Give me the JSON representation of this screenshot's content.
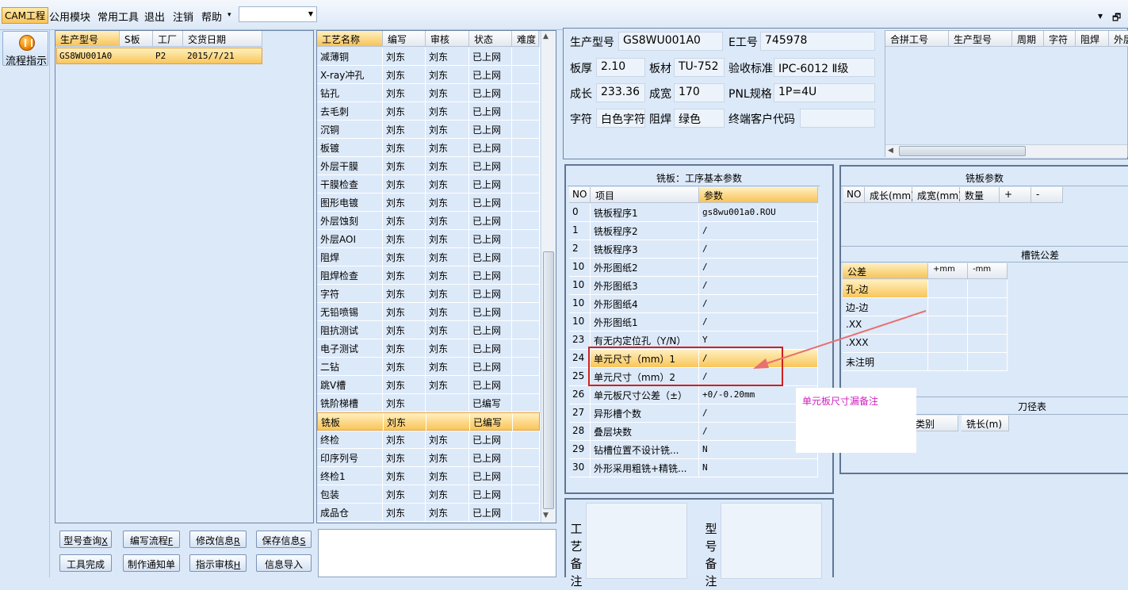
{
  "menubar": {
    "items": [
      "CAM工程",
      "公用模块",
      "常用工具",
      "退出",
      "注销",
      "帮助"
    ],
    "help_arrow": "▾",
    "combo_value": "",
    "window_controls": [
      "▾",
      "🗗"
    ]
  },
  "left_nav": {
    "flow_button": "流程指示"
  },
  "orders": {
    "columns": [
      "生产型号",
      "S板",
      "工厂",
      "交货日期"
    ],
    "rows": [
      [
        "GS8WU001A0",
        "",
        "P2",
        "2015/7/21"
      ]
    ]
  },
  "processes": {
    "columns": [
      "工艺名称",
      "编写",
      "审核",
      "状态",
      "难度"
    ],
    "rows": [
      [
        "减薄铜",
        "刘东",
        "刘东",
        "已上网",
        ""
      ],
      [
        "X-ray冲孔",
        "刘东",
        "刘东",
        "已上网",
        ""
      ],
      [
        "钻孔",
        "刘东",
        "刘东",
        "已上网",
        ""
      ],
      [
        "去毛刺",
        "刘东",
        "刘东",
        "已上网",
        ""
      ],
      [
        "沉铜",
        "刘东",
        "刘东",
        "已上网",
        ""
      ],
      [
        "板镀",
        "刘东",
        "刘东",
        "已上网",
        ""
      ],
      [
        "外层干膜",
        "刘东",
        "刘东",
        "已上网",
        ""
      ],
      [
        "干膜检查",
        "刘东",
        "刘东",
        "已上网",
        ""
      ],
      [
        "图形电镀",
        "刘东",
        "刘东",
        "已上网",
        ""
      ],
      [
        "外层蚀刻",
        "刘东",
        "刘东",
        "已上网",
        ""
      ],
      [
        "外层AOI",
        "刘东",
        "刘东",
        "已上网",
        ""
      ],
      [
        "阻焊",
        "刘东",
        "刘东",
        "已上网",
        ""
      ],
      [
        "阻焊检查",
        "刘东",
        "刘东",
        "已上网",
        ""
      ],
      [
        "字符",
        "刘东",
        "刘东",
        "已上网",
        ""
      ],
      [
        "无铅喷锡",
        "刘东",
        "刘东",
        "已上网",
        ""
      ],
      [
        "阻抗测试",
        "刘东",
        "刘东",
        "已上网",
        ""
      ],
      [
        "电子测试",
        "刘东",
        "刘东",
        "已上网",
        ""
      ],
      [
        "二钻",
        "刘东",
        "刘东",
        "已上网",
        ""
      ],
      [
        "跳V槽",
        "刘东",
        "刘东",
        "已上网",
        ""
      ],
      [
        "铣阶梯槽",
        "刘东",
        "",
        "已编写",
        ""
      ],
      [
        "铣板",
        "刘东",
        "",
        "已编写",
        ""
      ],
      [
        "终检",
        "刘东",
        "刘东",
        "已上网",
        ""
      ],
      [
        "印序列号",
        "刘东",
        "刘东",
        "已上网",
        ""
      ],
      [
        "终检1",
        "刘东",
        "刘东",
        "已上网",
        ""
      ],
      [
        "包装",
        "刘东",
        "刘东",
        "已上网",
        ""
      ],
      [
        "成品仓",
        "刘东",
        "刘东",
        "已上网",
        ""
      ]
    ],
    "selected_index": 20
  },
  "buttons": {
    "row1": [
      "型号查询",
      "编写流程",
      "修改信息",
      "保存信息"
    ],
    "row1_keys": [
      "X",
      "F",
      "R",
      "S"
    ],
    "row2": [
      "工具完成",
      "制作通知单",
      "指示审核",
      "信息导入"
    ],
    "row2_keys": [
      "",
      "",
      "H",
      ""
    ]
  },
  "info": {
    "生产型号_label": "生产型号",
    "生产型号": "GS8WU001A0",
    "E工号_label": "E工号",
    "E工号": "745978",
    "板厚_label": "板厚",
    "板厚": "2.10",
    "板材_label": "板材",
    "板材": "TU-752",
    "验收标准_label": "验收标准",
    "验收标准": "IPC-6012 Ⅱ级",
    "成长_label": "成长",
    "成长": "233.36",
    "成宽_label": "成宽",
    "成宽": "170",
    "PNL规格_label": "PNL规格",
    "PNL规格": "1P=4U",
    "字符_label": "字符",
    "字符": "白色字符",
    "阻焊_label": "阻焊",
    "阻焊": "绿色",
    "终端客户代码_label": "终端客户代码",
    "终端客户代码": ""
  },
  "merge_table": {
    "columns": [
      "合拼工号",
      "生产型号",
      "周期",
      "字符",
      "阻焊",
      "外层"
    ]
  },
  "mill_basic": {
    "title": "铣板：工序基本参数",
    "columns": [
      "NO",
      "项目",
      "参数"
    ],
    "rows": [
      [
        "0",
        "铣板程序1",
        "gs8wu001a0.ROU"
      ],
      [
        "1",
        "铣板程序2",
        "/"
      ],
      [
        "2",
        "铣板程序3",
        "/"
      ],
      [
        "10",
        "外形图纸2",
        "/"
      ],
      [
        "10",
        "外形图纸3",
        "/"
      ],
      [
        "10",
        "外形图纸4",
        "/"
      ],
      [
        "10",
        "外形图纸1",
        "/"
      ],
      [
        "23",
        "有无内定位孔（Y/N）",
        "Y"
      ],
      [
        "24",
        "单元尺寸（mm）1",
        "/"
      ],
      [
        "25",
        "单元尺寸（mm）2",
        "/"
      ],
      [
        "26",
        "单元板尺寸公差（±）",
        "+0/-0.20mm"
      ],
      [
        "27",
        "异形槽个数",
        "/"
      ],
      [
        "28",
        "叠层块数",
        "/"
      ],
      [
        "29",
        "钻槽位置不设计铣...",
        "N"
      ],
      [
        "30",
        "外形采用粗铣+精铣...",
        "N"
      ]
    ],
    "selected_index": 8
  },
  "mill_params": {
    "title": "铣板参数",
    "columns": [
      "NO",
      "成长(mm)",
      "成宽(mm)",
      "数量",
      "+",
      "-"
    ]
  },
  "slot_tol": {
    "title": "槽铣公差",
    "columns": [
      "公差",
      "+mm",
      "-mm"
    ],
    "rows": [
      "孔-边",
      "边-边",
      ".XX",
      ".XXX",
      "未注明"
    ]
  },
  "knife": {
    "title": "刀径表",
    "columns": [
      "类别",
      "铣长(m)"
    ]
  },
  "notes": {
    "left_label": "工艺备注",
    "right_label": "型号备注"
  },
  "annotation": {
    "text": "单元板尺寸漏备注",
    "arrow_color": "#e8706f",
    "box_color": "#d02020"
  }
}
